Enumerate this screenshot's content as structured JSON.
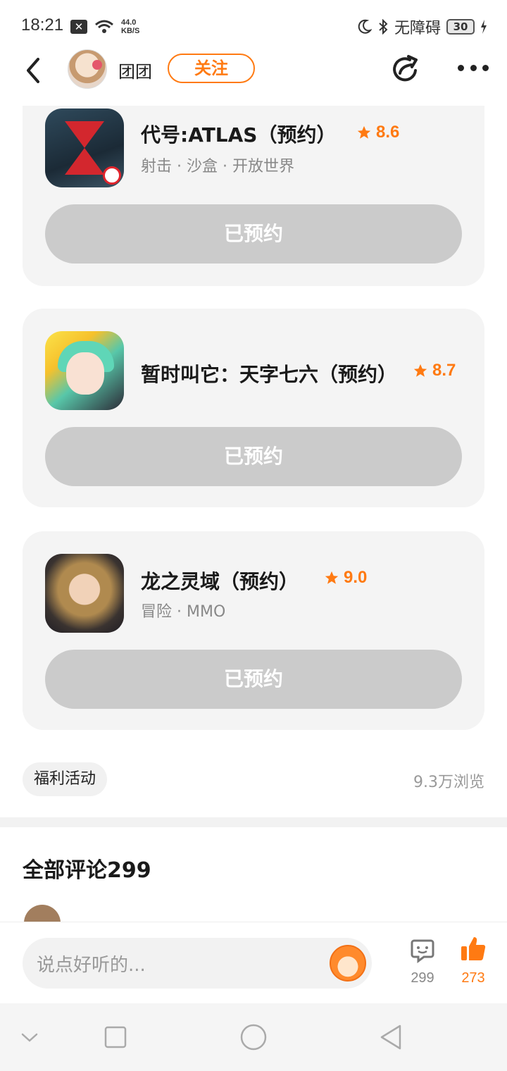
{
  "status_bar": {
    "time": "18:21",
    "net_speed_value": "44.0",
    "net_speed_unit": "KB/S",
    "accessibility": "无障碍",
    "battery": "30"
  },
  "header": {
    "author": "团团",
    "follow_label": "关注"
  },
  "games": [
    {
      "title": "代号:ATLAS（预约）",
      "rating": "8.6",
      "tags": "射击 · 沙盒 · 开放世界",
      "button": "已预约"
    },
    {
      "title": "暂时叫它：天字七六（预约）",
      "rating": "8.7",
      "tags": "",
      "button": "已预约"
    },
    {
      "title": "龙之灵域（预约）",
      "rating": "9.0",
      "tags": "冒险 · MMO",
      "button": "已预约"
    }
  ],
  "post_meta": {
    "tag": "福利活动",
    "views": "9.3万浏览"
  },
  "comments": {
    "title": "全部评论299"
  },
  "input_bar": {
    "placeholder": "说点好听的...",
    "comment_count": "299",
    "like_count": "273"
  },
  "colors": {
    "accent": "#ff7a12",
    "button_disabled": "#cbcbcb",
    "card_bg": "#f4f4f4"
  }
}
